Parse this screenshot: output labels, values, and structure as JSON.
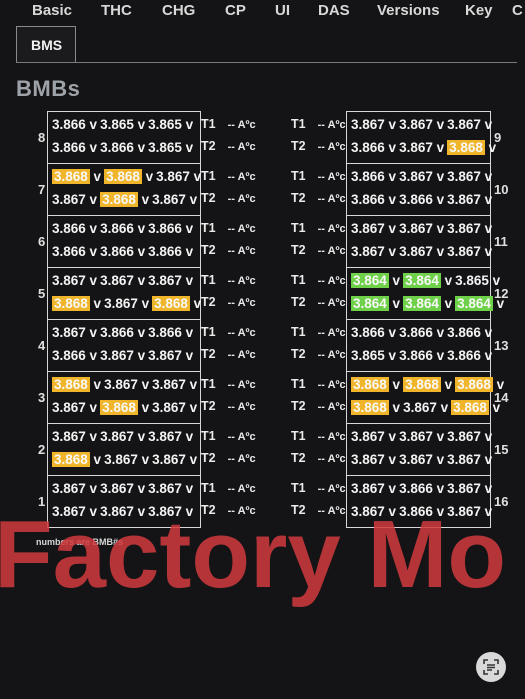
{
  "tabs": [
    "Basic",
    "THC",
    "CHG",
    "CP",
    "UI",
    "DAS",
    "Versions",
    "Key",
    "C"
  ],
  "subtab": "BMS",
  "heading": "BMBs",
  "left_modules": [
    {
      "index": "8",
      "l1": [
        {
          "v": "3.866",
          "h": ""
        },
        {
          "v": "3.865",
          "h": ""
        },
        {
          "v": "3.865",
          "h": ""
        }
      ],
      "l2": [
        {
          "v": "3.866",
          "h": ""
        },
        {
          "v": "3.866",
          "h": ""
        },
        {
          "v": "3.865",
          "h": ""
        }
      ]
    },
    {
      "index": "7",
      "l1": [
        {
          "v": "3.868",
          "h": "orange"
        },
        {
          "v": "3.868",
          "h": "orange"
        },
        {
          "v": "3.867",
          "h": ""
        }
      ],
      "l2": [
        {
          "v": "3.867",
          "h": ""
        },
        {
          "v": "3.868",
          "h": "orange"
        },
        {
          "v": "3.867",
          "h": ""
        }
      ]
    },
    {
      "index": "6",
      "l1": [
        {
          "v": "3.866",
          "h": ""
        },
        {
          "v": "3.866",
          "h": ""
        },
        {
          "v": "3.866",
          "h": ""
        }
      ],
      "l2": [
        {
          "v": "3.866",
          "h": ""
        },
        {
          "v": "3.866",
          "h": ""
        },
        {
          "v": "3.866",
          "h": ""
        }
      ]
    },
    {
      "index": "5",
      "l1": [
        {
          "v": "3.867",
          "h": ""
        },
        {
          "v": "3.867",
          "h": ""
        },
        {
          "v": "3.867",
          "h": ""
        }
      ],
      "l2": [
        {
          "v": "3.868",
          "h": "orange"
        },
        {
          "v": "3.867",
          "h": ""
        },
        {
          "v": "3.868",
          "h": "orange"
        }
      ]
    },
    {
      "index": "4",
      "l1": [
        {
          "v": "3.867",
          "h": ""
        },
        {
          "v": "3.866",
          "h": ""
        },
        {
          "v": "3.866",
          "h": ""
        }
      ],
      "l2": [
        {
          "v": "3.866",
          "h": ""
        },
        {
          "v": "3.867",
          "h": ""
        },
        {
          "v": "3.867",
          "h": ""
        }
      ]
    },
    {
      "index": "3",
      "l1": [
        {
          "v": "3.868",
          "h": "orange"
        },
        {
          "v": "3.867",
          "h": ""
        },
        {
          "v": "3.867",
          "h": ""
        }
      ],
      "l2": [
        {
          "v": "3.867",
          "h": ""
        },
        {
          "v": "3.868",
          "h": "orange"
        },
        {
          "v": "3.867",
          "h": ""
        }
      ]
    },
    {
      "index": "2",
      "l1": [
        {
          "v": "3.867",
          "h": ""
        },
        {
          "v": "3.867",
          "h": ""
        },
        {
          "v": "3.867",
          "h": ""
        }
      ],
      "l2": [
        {
          "v": "3.868",
          "h": "orange"
        },
        {
          "v": "3.867",
          "h": ""
        },
        {
          "v": "3.867",
          "h": ""
        }
      ]
    },
    {
      "index": "1",
      "l1": [
        {
          "v": "3.867",
          "h": ""
        },
        {
          "v": "3.867",
          "h": ""
        },
        {
          "v": "3.867",
          "h": ""
        }
      ],
      "l2": [
        {
          "v": "3.867",
          "h": ""
        },
        {
          "v": "3.867",
          "h": ""
        },
        {
          "v": "3.867",
          "h": ""
        }
      ]
    }
  ],
  "right_modules": [
    {
      "index": "9",
      "l1": [
        {
          "v": "3.867",
          "h": ""
        },
        {
          "v": "3.867",
          "h": ""
        },
        {
          "v": "3.867",
          "h": ""
        }
      ],
      "l2": [
        {
          "v": "3.866",
          "h": ""
        },
        {
          "v": "3.867",
          "h": ""
        },
        {
          "v": "3.868",
          "h": "orange"
        }
      ]
    },
    {
      "index": "10",
      "l1": [
        {
          "v": "3.866",
          "h": ""
        },
        {
          "v": "3.867",
          "h": ""
        },
        {
          "v": "3.867",
          "h": ""
        }
      ],
      "l2": [
        {
          "v": "3.866",
          "h": ""
        },
        {
          "v": "3.866",
          "h": ""
        },
        {
          "v": "3.867",
          "h": ""
        }
      ]
    },
    {
      "index": "11",
      "l1": [
        {
          "v": "3.867",
          "h": ""
        },
        {
          "v": "3.867",
          "h": ""
        },
        {
          "v": "3.867",
          "h": ""
        }
      ],
      "l2": [
        {
          "v": "3.867",
          "h": ""
        },
        {
          "v": "3.867",
          "h": ""
        },
        {
          "v": "3.867",
          "h": ""
        }
      ]
    },
    {
      "index": "12",
      "l1": [
        {
          "v": "3.864",
          "h": "green"
        },
        {
          "v": "3.864",
          "h": "green"
        },
        {
          "v": "3.865",
          "h": ""
        }
      ],
      "l2": [
        {
          "v": "3.864",
          "h": "green"
        },
        {
          "v": "3.864",
          "h": "green"
        },
        {
          "v": "3.864",
          "h": "green"
        }
      ]
    },
    {
      "index": "13",
      "l1": [
        {
          "v": "3.866",
          "h": ""
        },
        {
          "v": "3.866",
          "h": ""
        },
        {
          "v": "3.866",
          "h": ""
        }
      ],
      "l2": [
        {
          "v": "3.865",
          "h": ""
        },
        {
          "v": "3.866",
          "h": ""
        },
        {
          "v": "3.866",
          "h": ""
        }
      ]
    },
    {
      "index": "14",
      "l1": [
        {
          "v": "3.868",
          "h": "orange"
        },
        {
          "v": "3.868",
          "h": "orange"
        },
        {
          "v": "3.868",
          "h": "orange"
        }
      ],
      "l2": [
        {
          "v": "3.868",
          "h": "orange"
        },
        {
          "v": "3.867",
          "h": ""
        },
        {
          "v": "3.868",
          "h": "orange"
        }
      ]
    },
    {
      "index": "15",
      "l1": [
        {
          "v": "3.867",
          "h": ""
        },
        {
          "v": "3.867",
          "h": ""
        },
        {
          "v": "3.867",
          "h": ""
        }
      ],
      "l2": [
        {
          "v": "3.867",
          "h": ""
        },
        {
          "v": "3.867",
          "h": ""
        },
        {
          "v": "3.867",
          "h": ""
        }
      ]
    },
    {
      "index": "16",
      "l1": [
        {
          "v": "3.867",
          "h": ""
        },
        {
          "v": "3.866",
          "h": ""
        },
        {
          "v": "3.867",
          "h": ""
        }
      ],
      "l2": [
        {
          "v": "3.867",
          "h": ""
        },
        {
          "v": "3.866",
          "h": ""
        },
        {
          "v": "3.867",
          "h": ""
        }
      ]
    }
  ],
  "unit_v": "v",
  "temp_labels": [
    "T1",
    "T2"
  ],
  "temp_value": "-- Aºc",
  "note": "numbers are BMB#s",
  "watermark": "Factory Mo",
  "colors": {
    "orange": "#f0b52a",
    "green": "#6fd04a",
    "watermark": "#d23a3e"
  },
  "icons": {
    "corner": "scan-text-icon"
  }
}
